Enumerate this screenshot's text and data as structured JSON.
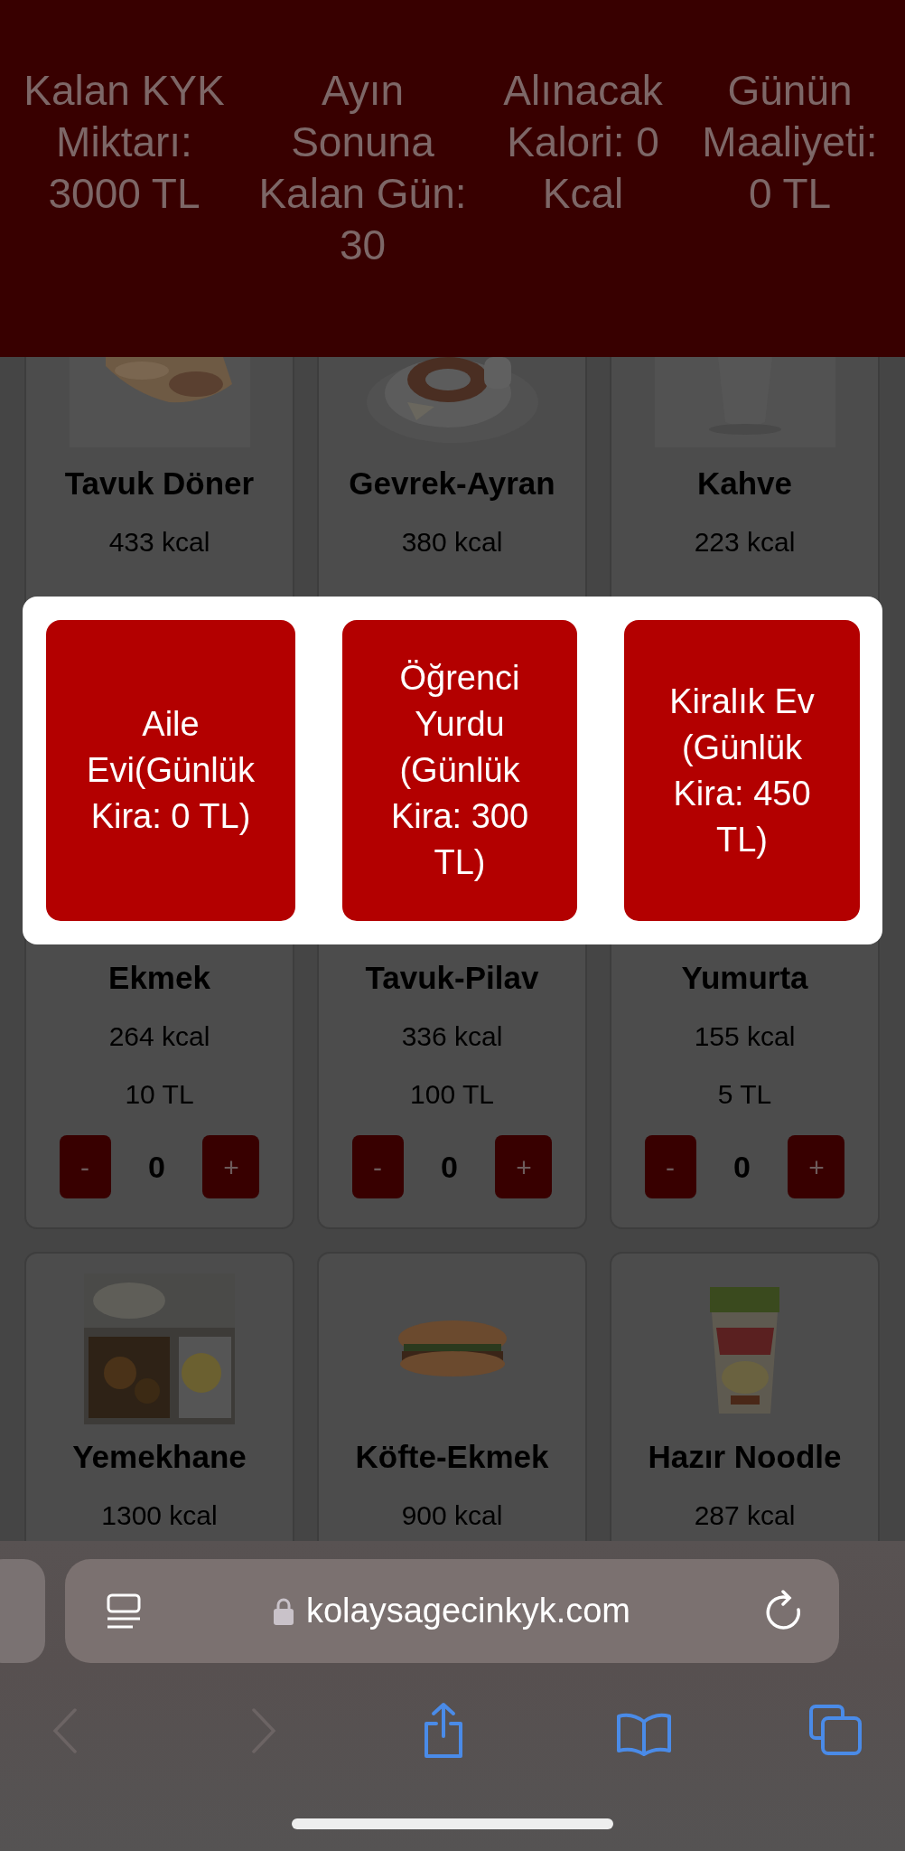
{
  "stats": [
    {
      "label": "Kalan KYK Miktarı: 3000 TL"
    },
    {
      "label": "Ayın Sonuna Kalan Gün: 30"
    },
    {
      "label": "Alınacak Kalori: 0 Kcal"
    },
    {
      "label": "Günün Maaliyeti: 0 TL"
    }
  ],
  "food_rows": [
    [
      {
        "name": "Tavuk Döner",
        "kcal": "433 kcal"
      },
      {
        "name": "Gevrek-Ayran",
        "kcal": "380 kcal"
      },
      {
        "name": "Kahve",
        "kcal": "223 kcal"
      }
    ],
    [
      {
        "name": "Ekmek",
        "kcal": "264 kcal",
        "price": "10 TL",
        "minus": "-",
        "count": "0",
        "plus": "+"
      },
      {
        "name": "Tavuk-Pilav",
        "kcal": "336 kcal",
        "price": "100 TL",
        "minus": "-",
        "count": "0",
        "plus": "+"
      },
      {
        "name": "Yumurta",
        "kcal": "155 kcal",
        "price": "5 TL",
        "minus": "-",
        "count": "0",
        "plus": "+"
      }
    ],
    [
      {
        "name": "Yemekhane",
        "kcal": "1300 kcal"
      },
      {
        "name": "Köfte-Ekmek",
        "kcal": "900 kcal"
      },
      {
        "name": "Hazır Noodle",
        "kcal": "287 kcal"
      }
    ]
  ],
  "modal": {
    "options": [
      {
        "label": "Aile Evi(Günlük Kira: 0 TL)"
      },
      {
        "label": "Öğrenci Yurdu (Günlük Kira: 300 TL)"
      },
      {
        "label": "Kiralık Ev (Günlük Kira: 450 TL)"
      }
    ]
  },
  "browser": {
    "url": "kolaysagecinkyk.com"
  }
}
